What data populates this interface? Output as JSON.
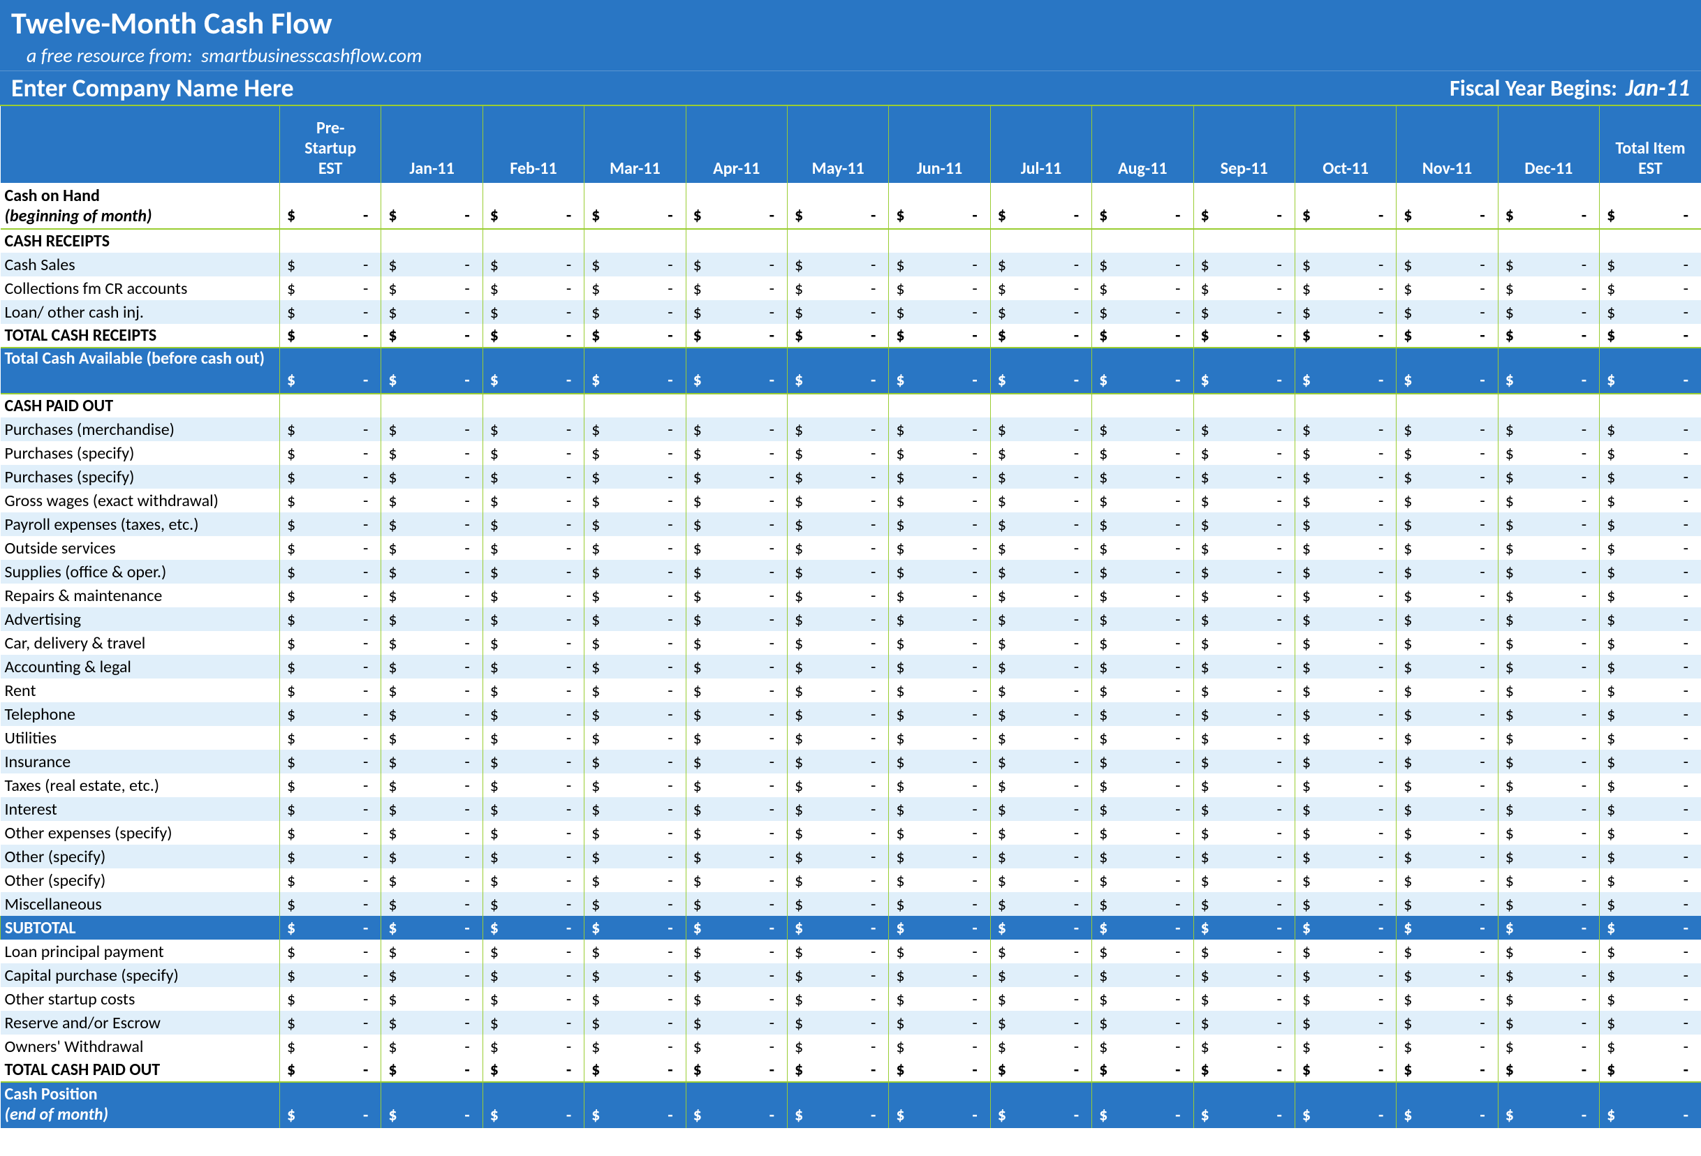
{
  "header": {
    "title": "Twelve-Month Cash Flow",
    "subtitle_prefix": "a free resource from:",
    "subtitle_link": "smartbusinesscashflow.com",
    "company_placeholder": "Enter Company Name Here",
    "fiscal_year_label": "Fiscal Year Begins:",
    "fiscal_year_value": "Jan-11"
  },
  "columns": [
    "Pre-Startup EST",
    "Jan-11",
    "Feb-11",
    "Mar-11",
    "Apr-11",
    "May-11",
    "Jun-11",
    "Jul-11",
    "Aug-11",
    "Sep-11",
    "Oct-11",
    "Nov-11",
    "Dec-11",
    "Total Item EST"
  ],
  "currency": "$",
  "empty": "-",
  "labels": {
    "cash_on_hand": "Cash on Hand",
    "beginning": "(beginning of month)",
    "cash_receipts": "CASH RECEIPTS",
    "total_cash_receipts": "TOTAL CASH RECEIPTS",
    "total_cash_available": "Total Cash Available (before cash out)",
    "cash_paid_out": "CASH PAID OUT",
    "subtotal": "SUBTOTAL",
    "total_cash_paid_out": "TOTAL CASH PAID OUT",
    "cash_position": "Cash Position",
    "end_of_month": "(end of month)"
  },
  "receipts_rows": [
    "Cash Sales",
    "Collections fm CR accounts",
    "Loan/ other cash inj."
  ],
  "paidout_rows": [
    "Purchases (merchandise)",
    "Purchases (specify)",
    "Purchases (specify)",
    "Gross wages (exact withdrawal)",
    "Payroll expenses (taxes, etc.)",
    "Outside services",
    "Supplies (office & oper.)",
    "Repairs & maintenance",
    "Advertising",
    "Car, delivery & travel",
    "Accounting & legal",
    "Rent",
    "Telephone",
    "Utilities",
    "Insurance",
    "Taxes (real estate, etc.)",
    "Interest",
    "Other expenses (specify)",
    "Other (specify)",
    "Other (specify)",
    "Miscellaneous"
  ],
  "post_subtotal_rows": [
    "Loan principal payment",
    "Capital purchase (specify)",
    "Other startup costs",
    "Reserve and/or Escrow",
    "Owners' Withdrawal"
  ]
}
